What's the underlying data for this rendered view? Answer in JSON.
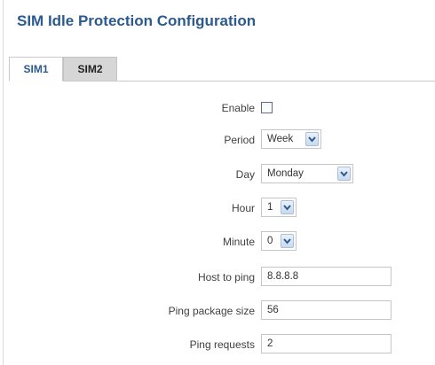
{
  "page": {
    "title": "SIM Idle Protection Configuration"
  },
  "tabs": [
    {
      "label": "SIM1",
      "active": true
    },
    {
      "label": "SIM2",
      "active": false
    }
  ],
  "form": {
    "enable": {
      "label": "Enable",
      "checked": false
    },
    "period": {
      "label": "Period",
      "value": "Week"
    },
    "day": {
      "label": "Day",
      "value": "Monday"
    },
    "hour": {
      "label": "Hour",
      "value": "1"
    },
    "minute": {
      "label": "Minute",
      "value": "0"
    },
    "host": {
      "label": "Host to ping",
      "value": "8.8.8.8"
    },
    "ping_size": {
      "label": "Ping package size",
      "value": "56"
    },
    "ping_requests": {
      "label": "Ping requests",
      "value": "2"
    }
  },
  "colors": {
    "title": "#2c5a8f",
    "tab_inactive_bg": "#d6d6d6",
    "dropdown_arrow": "#2c5a8f"
  },
  "icons": {
    "dropdown": "chevron-down-icon"
  }
}
